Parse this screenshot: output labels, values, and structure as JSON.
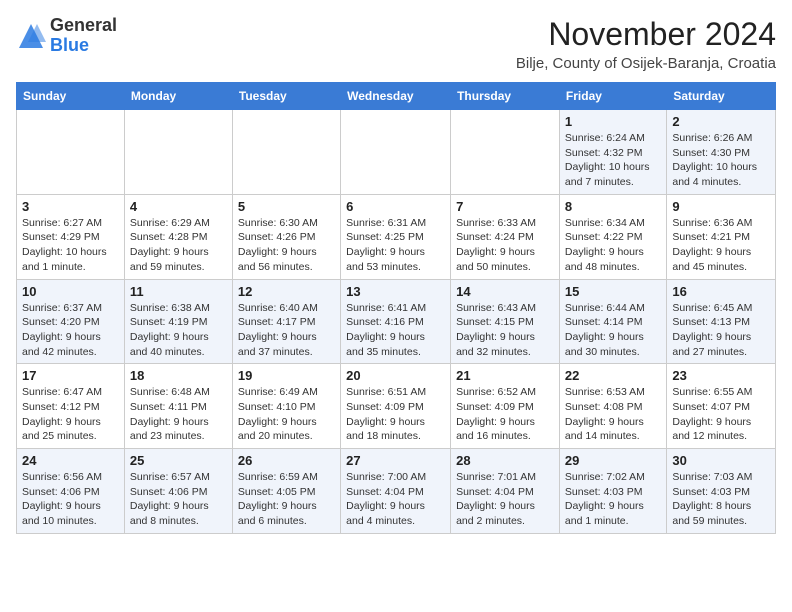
{
  "logo": {
    "general": "General",
    "blue": "Blue"
  },
  "header": {
    "month": "November 2024",
    "subtitle": "Bilje, County of Osijek-Baranja, Croatia"
  },
  "weekdays": [
    "Sunday",
    "Monday",
    "Tuesday",
    "Wednesday",
    "Thursday",
    "Friday",
    "Saturday"
  ],
  "weeks": [
    [
      {
        "day": "",
        "info": ""
      },
      {
        "day": "",
        "info": ""
      },
      {
        "day": "",
        "info": ""
      },
      {
        "day": "",
        "info": ""
      },
      {
        "day": "",
        "info": ""
      },
      {
        "day": "1",
        "info": "Sunrise: 6:24 AM\nSunset: 4:32 PM\nDaylight: 10 hours and 7 minutes."
      },
      {
        "day": "2",
        "info": "Sunrise: 6:26 AM\nSunset: 4:30 PM\nDaylight: 10 hours and 4 minutes."
      }
    ],
    [
      {
        "day": "3",
        "info": "Sunrise: 6:27 AM\nSunset: 4:29 PM\nDaylight: 10 hours and 1 minute."
      },
      {
        "day": "4",
        "info": "Sunrise: 6:29 AM\nSunset: 4:28 PM\nDaylight: 9 hours and 59 minutes."
      },
      {
        "day": "5",
        "info": "Sunrise: 6:30 AM\nSunset: 4:26 PM\nDaylight: 9 hours and 56 minutes."
      },
      {
        "day": "6",
        "info": "Sunrise: 6:31 AM\nSunset: 4:25 PM\nDaylight: 9 hours and 53 minutes."
      },
      {
        "day": "7",
        "info": "Sunrise: 6:33 AM\nSunset: 4:24 PM\nDaylight: 9 hours and 50 minutes."
      },
      {
        "day": "8",
        "info": "Sunrise: 6:34 AM\nSunset: 4:22 PM\nDaylight: 9 hours and 48 minutes."
      },
      {
        "day": "9",
        "info": "Sunrise: 6:36 AM\nSunset: 4:21 PM\nDaylight: 9 hours and 45 minutes."
      }
    ],
    [
      {
        "day": "10",
        "info": "Sunrise: 6:37 AM\nSunset: 4:20 PM\nDaylight: 9 hours and 42 minutes."
      },
      {
        "day": "11",
        "info": "Sunrise: 6:38 AM\nSunset: 4:19 PM\nDaylight: 9 hours and 40 minutes."
      },
      {
        "day": "12",
        "info": "Sunrise: 6:40 AM\nSunset: 4:17 PM\nDaylight: 9 hours and 37 minutes."
      },
      {
        "day": "13",
        "info": "Sunrise: 6:41 AM\nSunset: 4:16 PM\nDaylight: 9 hours and 35 minutes."
      },
      {
        "day": "14",
        "info": "Sunrise: 6:43 AM\nSunset: 4:15 PM\nDaylight: 9 hours and 32 minutes."
      },
      {
        "day": "15",
        "info": "Sunrise: 6:44 AM\nSunset: 4:14 PM\nDaylight: 9 hours and 30 minutes."
      },
      {
        "day": "16",
        "info": "Sunrise: 6:45 AM\nSunset: 4:13 PM\nDaylight: 9 hours and 27 minutes."
      }
    ],
    [
      {
        "day": "17",
        "info": "Sunrise: 6:47 AM\nSunset: 4:12 PM\nDaylight: 9 hours and 25 minutes."
      },
      {
        "day": "18",
        "info": "Sunrise: 6:48 AM\nSunset: 4:11 PM\nDaylight: 9 hours and 23 minutes."
      },
      {
        "day": "19",
        "info": "Sunrise: 6:49 AM\nSunset: 4:10 PM\nDaylight: 9 hours and 20 minutes."
      },
      {
        "day": "20",
        "info": "Sunrise: 6:51 AM\nSunset: 4:09 PM\nDaylight: 9 hours and 18 minutes."
      },
      {
        "day": "21",
        "info": "Sunrise: 6:52 AM\nSunset: 4:09 PM\nDaylight: 9 hours and 16 minutes."
      },
      {
        "day": "22",
        "info": "Sunrise: 6:53 AM\nSunset: 4:08 PM\nDaylight: 9 hours and 14 minutes."
      },
      {
        "day": "23",
        "info": "Sunrise: 6:55 AM\nSunset: 4:07 PM\nDaylight: 9 hours and 12 minutes."
      }
    ],
    [
      {
        "day": "24",
        "info": "Sunrise: 6:56 AM\nSunset: 4:06 PM\nDaylight: 9 hours and 10 minutes."
      },
      {
        "day": "25",
        "info": "Sunrise: 6:57 AM\nSunset: 4:06 PM\nDaylight: 9 hours and 8 minutes."
      },
      {
        "day": "26",
        "info": "Sunrise: 6:59 AM\nSunset: 4:05 PM\nDaylight: 9 hours and 6 minutes."
      },
      {
        "day": "27",
        "info": "Sunrise: 7:00 AM\nSunset: 4:04 PM\nDaylight: 9 hours and 4 minutes."
      },
      {
        "day": "28",
        "info": "Sunrise: 7:01 AM\nSunset: 4:04 PM\nDaylight: 9 hours and 2 minutes."
      },
      {
        "day": "29",
        "info": "Sunrise: 7:02 AM\nSunset: 4:03 PM\nDaylight: 9 hours and 1 minute."
      },
      {
        "day": "30",
        "info": "Sunrise: 7:03 AM\nSunset: 4:03 PM\nDaylight: 8 hours and 59 minutes."
      }
    ]
  ]
}
